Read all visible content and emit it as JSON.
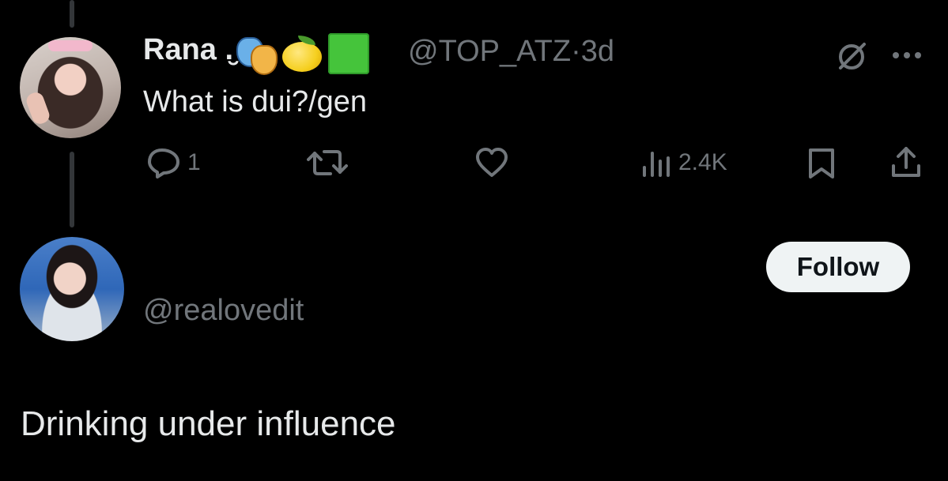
{
  "tweet": {
    "author_name": "Rana .̮",
    "emojis": [
      "performing-arts",
      "lemon",
      "green-square"
    ],
    "handle": "@TOP_ATZ",
    "separator": "·",
    "time": "3d",
    "text": "What is dui?/gen",
    "actions": {
      "reply_count": "1",
      "views_count": "2.4K"
    }
  },
  "profile_card": {
    "handle": "@realovedit",
    "follow_label": "Follow",
    "bio": "Drinking under influence"
  },
  "icons": [
    "reply-icon",
    "retweet-icon",
    "like-icon",
    "views-icon",
    "bookmark-icon",
    "share-icon",
    "grok-icon",
    "more-icon"
  ],
  "colors": {
    "background": "#000000",
    "text": "#e7e9ea",
    "muted": "#71767b",
    "thread_line": "#333639",
    "follow_button_bg": "#eff3f4"
  }
}
